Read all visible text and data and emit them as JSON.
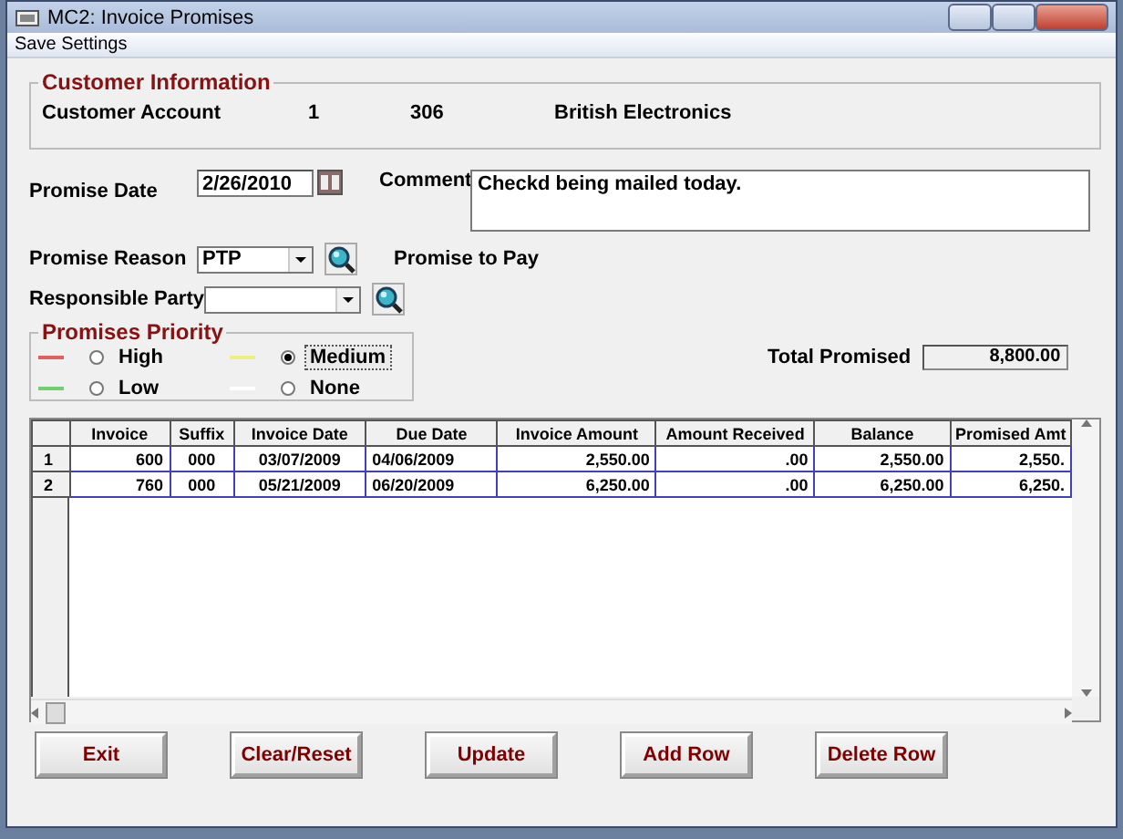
{
  "window": {
    "title": "MC2: Invoice Promises"
  },
  "menu": [
    {
      "label": "Save Settings"
    }
  ],
  "customer_info": {
    "title": "Customer Information",
    "label": "Customer Account",
    "values": [
      "1",
      "306",
      "British Electronics"
    ]
  },
  "promise_date": {
    "label": "Promise Date",
    "value": "2/26/2010"
  },
  "comment": {
    "label": "Comment",
    "value": "Checkd being mailed today."
  },
  "promise_reason": {
    "label": "Promise Reason",
    "value": "PTP",
    "description": "Promise to Pay"
  },
  "responsible_party": {
    "label": "Responsible Party"
  },
  "priority": {
    "title": "Promises Priority",
    "options": [
      {
        "label": "High",
        "color": "#e06060",
        "selected": false
      },
      {
        "label": "Medium",
        "color": "#f0f080",
        "selected": true
      },
      {
        "label": "Low",
        "color": "#70d070",
        "selected": false
      },
      {
        "label": "None",
        "color": "#ffffff",
        "selected": false
      }
    ]
  },
  "total_promised": {
    "label": "Total Promised",
    "value": "8,800.00"
  },
  "grid": {
    "columns": [
      "Invoice",
      "Suffix",
      "Invoice Date",
      "Due Date",
      "Invoice Amount",
      "Amount Received",
      "Balance",
      "Promised Amt"
    ],
    "rows": [
      {
        "number": "1",
        "cells": [
          "600",
          "000",
          "03/07/2009",
          "04/06/2009",
          "2,550.00",
          ".00",
          "2,550.00",
          "2,550."
        ]
      },
      {
        "number": "2",
        "cells": [
          "760",
          "000",
          "05/21/2009",
          "06/20/2009",
          "6,250.00",
          ".00",
          "6,250.00",
          "6,250."
        ]
      }
    ]
  },
  "buttons": [
    "Exit",
    "Clear/Reset",
    "Update",
    "Add Row",
    "Delete Row"
  ]
}
